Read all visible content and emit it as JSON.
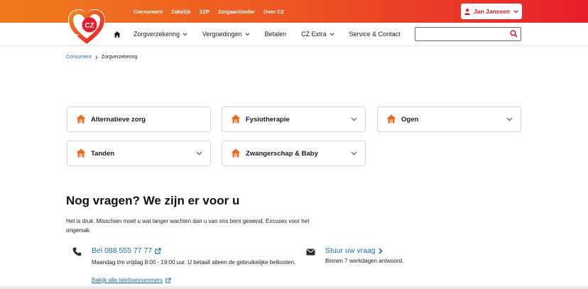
{
  "brand": {
    "logo_text": "CZ",
    "colors": {
      "orange": "#f07a1e",
      "red": "#e81e2b",
      "link": "#1a6fa8",
      "house": "#ee6a1f"
    }
  },
  "topbar": {
    "links": [
      "Consument",
      "Zakelijk",
      "ZZP",
      "Zorgaanbieder",
      "Over CZ"
    ],
    "user": {
      "name": "Jan Janssen",
      "icon": "user-icon"
    }
  },
  "nav": {
    "home_icon": "home-icon",
    "items": [
      {
        "label": "Zorgverzekering",
        "dropdown": true
      },
      {
        "label": "Vergoedingen",
        "dropdown": true
      },
      {
        "label": "Betalen",
        "dropdown": false
      },
      {
        "label": "CZ Extra",
        "dropdown": true
      },
      {
        "label": "Service & Contact",
        "dropdown": false
      }
    ],
    "search": {
      "placeholder": "",
      "icon": "search-icon"
    }
  },
  "breadcrumb": {
    "items": [
      "Consument",
      "Zorgverzekering"
    ]
  },
  "categories": [
    {
      "label": "Alternatieve zorg",
      "expandable": false
    },
    {
      "label": "Fysiotherapie",
      "expandable": true
    },
    {
      "label": "Ogen",
      "expandable": true
    },
    {
      "label": "Tanden",
      "expandable": true
    },
    {
      "label": "Zwangerschap & Baby",
      "expandable": true
    }
  ],
  "contact": {
    "heading": "Nog vragen? We zijn er voor u",
    "intro": "Het is druk. Misschien moet u wat langer wachten dan u van ons bent gewend. Excuses voor het ongemak.",
    "phone": {
      "label": "Bel 088 555 77 77",
      "description": "Maandag t/m vrijdag 8:00 - 19:00 uur. U betaalt alleen de gebruikelijke belkosten.",
      "all_numbers": "Bekijk alle telefoonnummers"
    },
    "mail": {
      "label": "Stuur uw vraag",
      "description": "Binnen 7 werkdagen antwoord."
    }
  }
}
